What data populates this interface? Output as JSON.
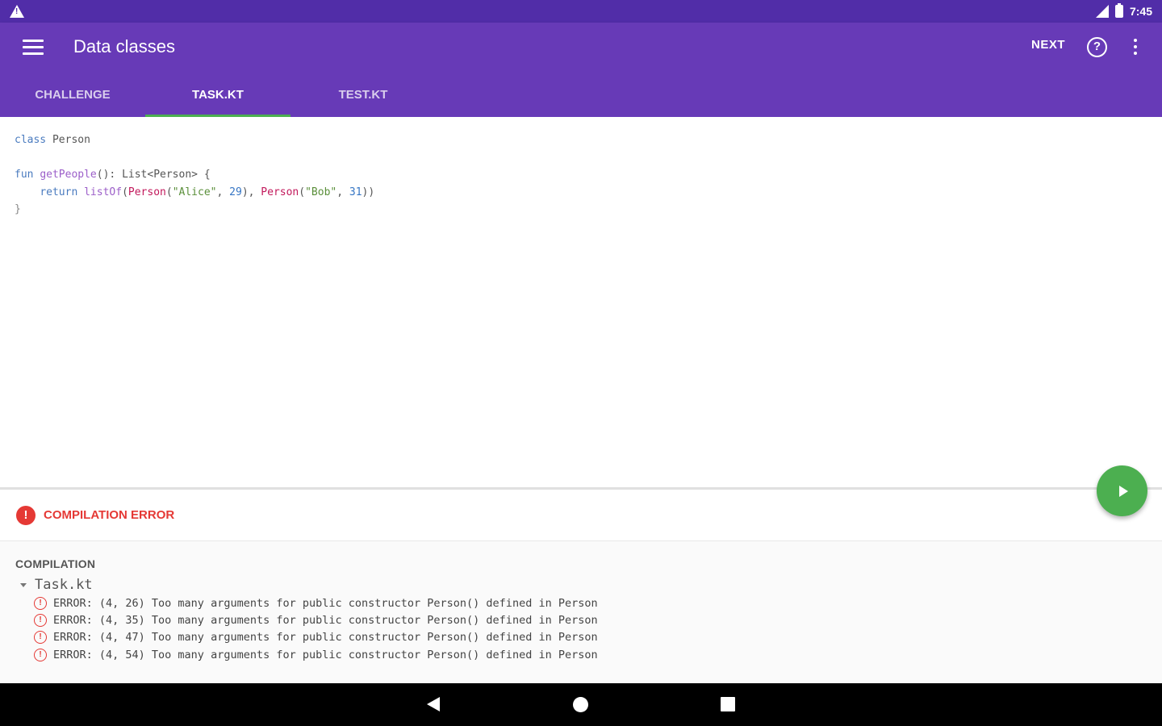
{
  "status_bar": {
    "time": "7:45",
    "icons": [
      "warning-icon",
      "signal-icon",
      "battery-icon"
    ]
  },
  "app_bar": {
    "title": "Data classes",
    "next_label": "NEXT",
    "help_icon_glyph": "?",
    "color": "#673ab7",
    "status_color": "#512da8"
  },
  "tabs": [
    {
      "label": "CHALLENGE",
      "active": false
    },
    {
      "label": "TASK.KT",
      "active": true
    },
    {
      "label": "TEST.KT",
      "active": false
    }
  ],
  "code": {
    "line1": {
      "kw": "class",
      "rest": " Person"
    },
    "line3": {
      "kw": "fun",
      "fn": "getPeople",
      "rest": "(): List<Person> {"
    },
    "line4": {
      "indent": "    ",
      "kw": "return",
      "fn": "listOf",
      "ctor": "Person",
      "str1": "\"Alice\"",
      "num1": "29",
      "str2": "\"Bob\"",
      "num2": "31"
    },
    "line5": "}"
  },
  "compile_status": {
    "text": "COMPILATION ERROR",
    "color": "#e53935"
  },
  "output": {
    "section_title": "COMPILATION",
    "file_name": "Task.kt",
    "errors": [
      "ERROR: (4, 26) Too many arguments for public constructor Person() defined in Person",
      "ERROR: (4, 35) Too many arguments for public constructor Person() defined in Person",
      "ERROR: (4, 47) Too many arguments for public constructor Person() defined in Person",
      "ERROR: (4, 54) Too many arguments for public constructor Person() defined in Person"
    ]
  },
  "fab": {
    "icon": "play-icon",
    "color": "#4caf50"
  }
}
